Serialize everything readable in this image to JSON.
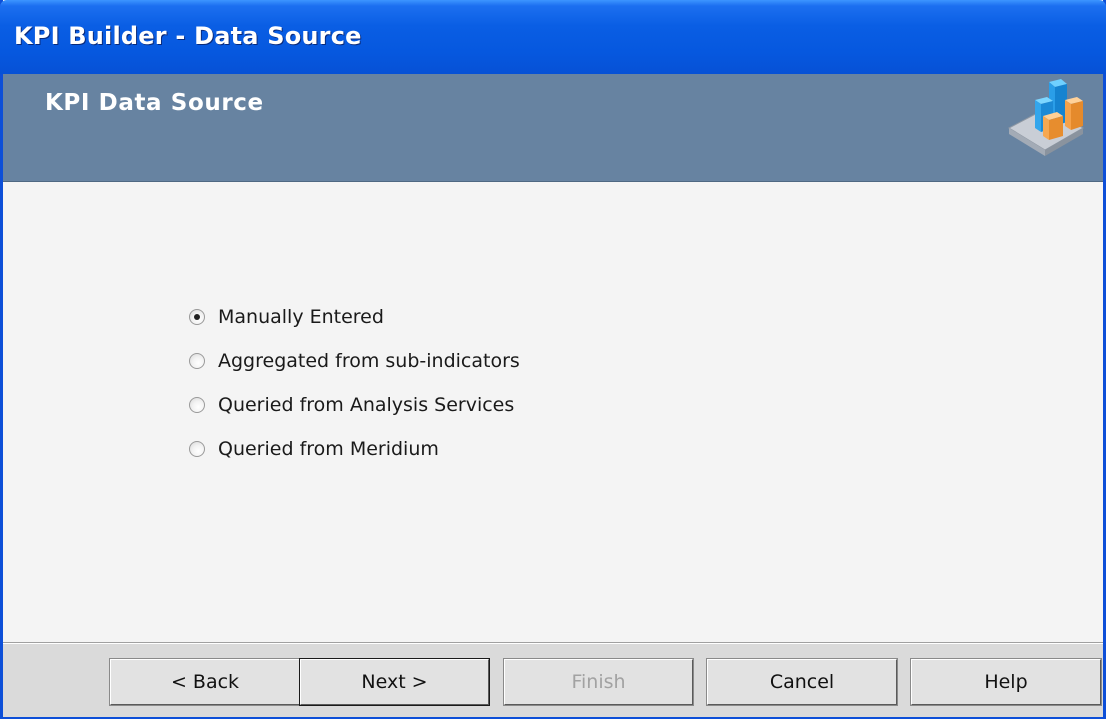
{
  "window": {
    "title": "KPI Builder - Data Source"
  },
  "header": {
    "heading": "KPI Data Source",
    "icon": "kpi-chart-icon"
  },
  "data_source": {
    "options": [
      {
        "label": "Manually Entered",
        "checked": true
      },
      {
        "label": "Aggregated from sub-indicators",
        "checked": false
      },
      {
        "label": "Queried from Analysis Services",
        "checked": false
      },
      {
        "label": "Queried from Meridium",
        "checked": false
      }
    ]
  },
  "buttons": {
    "back": "< Back",
    "next": "Next >",
    "finish": "Finish",
    "cancel": "Cancel",
    "help": "Help"
  },
  "colors": {
    "titlebar": "#0658df",
    "header_band": "#6783a1",
    "content_bg": "#f4f4f4",
    "footer_bg": "#dadada"
  }
}
